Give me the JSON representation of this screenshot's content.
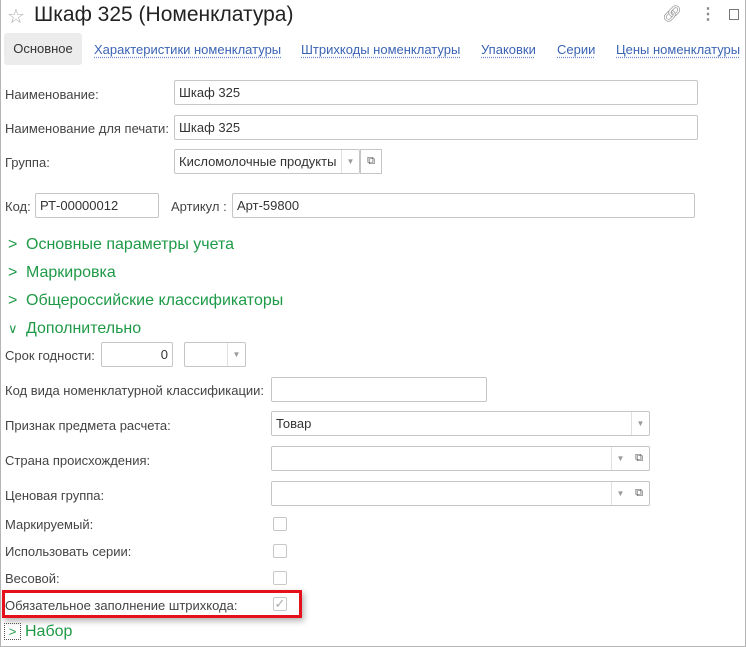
{
  "header": {
    "title": "Шкаф 325 (Номенклатура)"
  },
  "tabs": [
    "Основное",
    "Характеристики номенклатуры",
    "Штрихкоды номенклатуры",
    "Упаковки",
    "Серии",
    "Цены номенклатуры"
  ],
  "fields": {
    "name": {
      "label": "Наименование:",
      "value": "Шкаф 325"
    },
    "print_name": {
      "label": "Наименование для печати:",
      "value": "Шкаф 325"
    },
    "group": {
      "label": "Группа:",
      "value": "Кисломолочные продукты"
    },
    "code": {
      "label": "Код:",
      "value": "РТ-00000012"
    },
    "article": {
      "label": "Артикул :",
      "value": "Арт-59800"
    }
  },
  "sections": [
    "Основные параметры учета",
    "Маркировка",
    "Общероссийские классификаторы",
    "Дополнительно"
  ],
  "extra": {
    "shelf_life": {
      "label": "Срок годности:",
      "value": "0",
      "unit": ""
    },
    "class_code": {
      "label": "Код вида номенклатурной классификации:",
      "value": ""
    },
    "calc_subject": {
      "label": "Признак предмета расчета:",
      "value": "Товар"
    },
    "country": {
      "label": "Страна происхождения:",
      "value": ""
    },
    "price_group": {
      "label": "Ценовая группа:",
      "value": ""
    },
    "marked": {
      "label": "Маркируемый:",
      "checked": false
    },
    "use_series": {
      "label": "Использовать серии:",
      "checked": false
    },
    "weighted": {
      "label": "Весовой:",
      "checked": false
    },
    "barcode_required": {
      "label": "Обязательное заполнение штрихкода:",
      "checked": true
    }
  },
  "set_section": "Набор",
  "colors": {
    "accent_green": "#1e9a47",
    "link": "#3a63b3",
    "highlight": "#e4101a"
  }
}
